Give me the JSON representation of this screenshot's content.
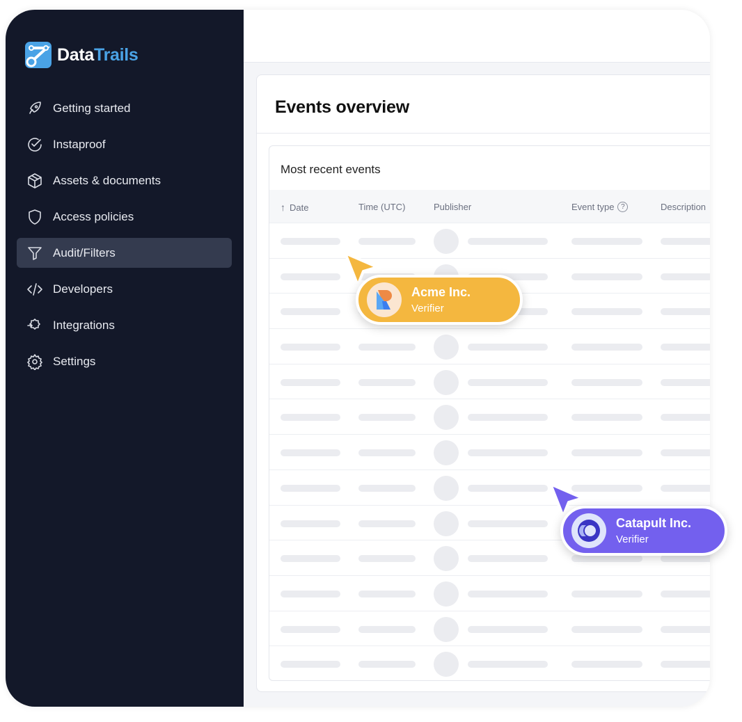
{
  "brand": {
    "name_part1": "Data",
    "name_part2": "Trails",
    "accent": "#4aa3e6"
  },
  "sidebar": {
    "items": [
      {
        "label": "Getting started",
        "icon": "rocket-icon"
      },
      {
        "label": "Instaproof",
        "icon": "check-circle-icon"
      },
      {
        "label": "Assets & documents",
        "icon": "box-icon"
      },
      {
        "label": "Access policies",
        "icon": "shield-icon"
      },
      {
        "label": "Audit/Filters",
        "icon": "filter-icon",
        "active": true
      },
      {
        "label": "Developers",
        "icon": "code-icon"
      },
      {
        "label": "Integrations",
        "icon": "integrations-icon"
      },
      {
        "label": "Settings",
        "icon": "gear-icon"
      }
    ]
  },
  "main": {
    "title": "Events overview",
    "table": {
      "title": "Most recent events",
      "columns": [
        "Date",
        "Time (UTC)",
        "Publisher",
        "Event type",
        "Description"
      ],
      "sort_column": "Date",
      "sort_direction": "ascending"
    }
  },
  "badges": [
    {
      "name": "Acme Inc.",
      "role": "Verifier",
      "color": "#f4b73f"
    },
    {
      "name": "Catapult Inc.",
      "role": "Verifier",
      "color": "#7360ee"
    }
  ]
}
